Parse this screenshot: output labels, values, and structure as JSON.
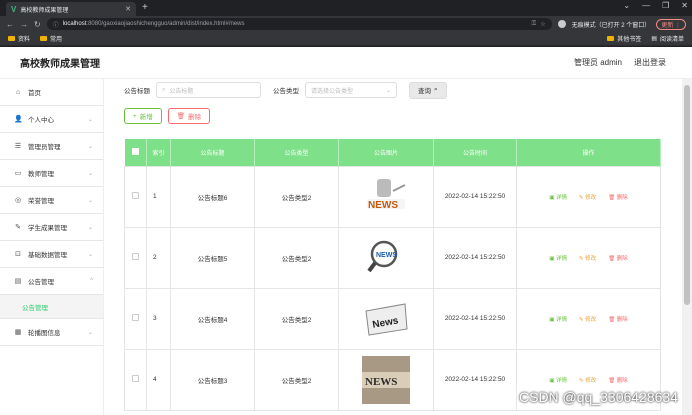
{
  "browser": {
    "tab_title": "高校教师成果管理",
    "favicon": "V",
    "url_host": "localhost",
    "url_rest": ":8080/gaoxiaojiaoshichengguo/admin/dist/index.html#/news",
    "incognito_text": "无痕模式（已打开 2 个窗口）",
    "update_label": "更新",
    "bookmarks": [
      "资料",
      "常用"
    ],
    "bookmarks_right": [
      "其他书签",
      "阅读清单"
    ]
  },
  "header": {
    "title": "高校教师成果管理",
    "admin_label": "管理员 admin",
    "logout_label": "退出登录"
  },
  "sidebar": {
    "items": [
      {
        "label": "首页",
        "icon": "home-icon",
        "glyph": "⌂",
        "chev": false
      },
      {
        "label": "个人中心",
        "icon": "user-icon",
        "glyph": "👤",
        "chev": true
      },
      {
        "label": "管理员管理",
        "icon": "sliders-icon",
        "glyph": "☰",
        "chev": true
      },
      {
        "label": "教师管理",
        "icon": "message-icon",
        "glyph": "▭",
        "chev": true
      },
      {
        "label": "荣誉管理",
        "icon": "award-icon",
        "glyph": "◎",
        "chev": true
      },
      {
        "label": "学生成果管理",
        "icon": "pen-icon",
        "glyph": "✎",
        "chev": true
      },
      {
        "label": "基础数据管理",
        "icon": "crop-icon",
        "glyph": "⊡",
        "chev": true
      },
      {
        "label": "公告管理",
        "icon": "list-icon",
        "glyph": "▤",
        "chev": true
      }
    ],
    "sub_item": "公告管理",
    "last_item": {
      "label": "轮播图信息",
      "icon": "grid-icon",
      "glyph": "▦"
    }
  },
  "search": {
    "title_label": "公告标题",
    "title_placeholder": "公告标题",
    "type_label": "公告类型",
    "type_placeholder": "请选择公告类型",
    "query_label": "查询"
  },
  "actions": {
    "add_label": "新增",
    "delete_label": "删除"
  },
  "table": {
    "columns": [
      "索引",
      "公告标题",
      "公告类型",
      "公告图片",
      "公告时间",
      "操作"
    ],
    "rows": [
      {
        "index": "1",
        "title": "公告标题6",
        "type": "公告类型2",
        "time": "2022-02-14 15:22:50"
      },
      {
        "index": "2",
        "title": "公告标题5",
        "type": "公告类型2",
        "time": "2022-02-14 15:22:50"
      },
      {
        "index": "3",
        "title": "公告标题4",
        "type": "公告类型2",
        "time": "2022-02-14 15:22:50"
      },
      {
        "index": "4",
        "title": "公告标题3",
        "type": "公告类型2",
        "time": "2022-02-14 15:22:50"
      }
    ],
    "op_detail": "详情",
    "op_edit": "修改",
    "op_delete": "删除"
  },
  "watermark": "CSDN @qq_3306428634",
  "colors": {
    "accent": "#7fe08a",
    "success": "#67c23a",
    "warning": "#e6a23c",
    "danger": "#f56c6c"
  }
}
